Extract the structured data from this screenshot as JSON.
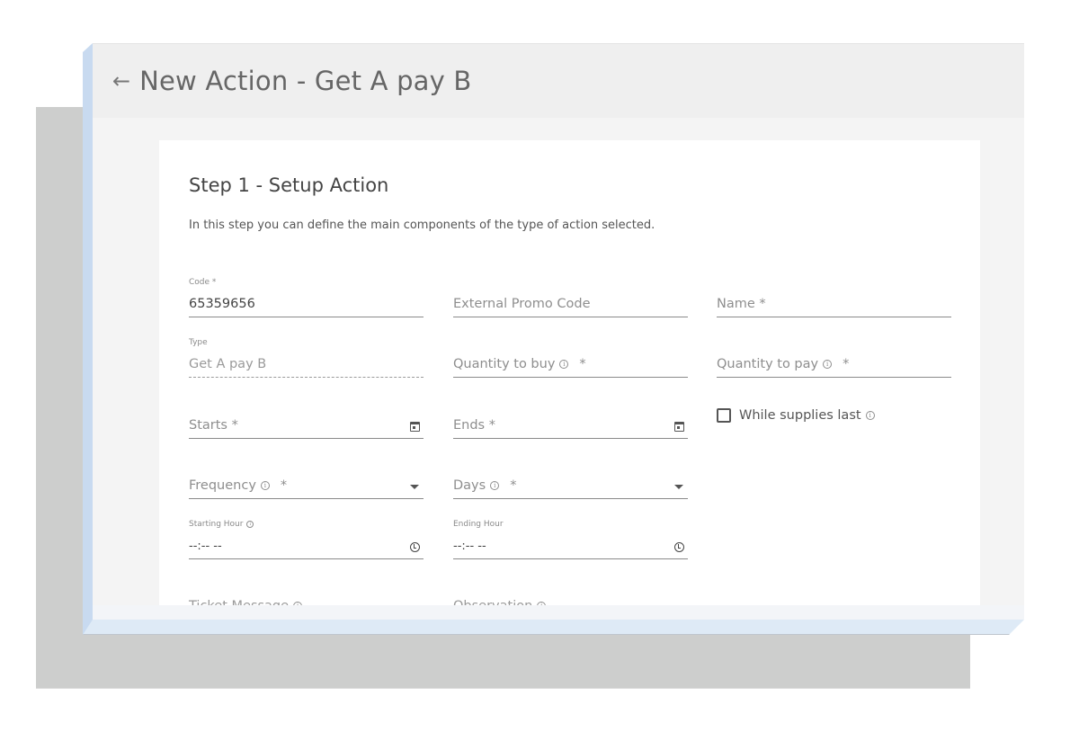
{
  "header": {
    "back_icon": "arrow-left-icon",
    "title": "New Action - Get A pay B"
  },
  "step": {
    "title": "Step 1 - Setup Action",
    "description": "In this step you can define the main components of the type of action selected."
  },
  "fields": {
    "code": {
      "label": "Code *",
      "value": "65359656"
    },
    "external_promo_code": {
      "placeholder": "External Promo Code"
    },
    "name": {
      "placeholder": "Name *"
    },
    "type": {
      "label": "Type",
      "value": "Get A pay B"
    },
    "quantity_to_buy": {
      "placeholder": "Quantity to buy",
      "required": "*"
    },
    "quantity_to_pay": {
      "placeholder": "Quantity to pay",
      "required": "*"
    },
    "starts": {
      "placeholder": "Starts *",
      "icon": "calendar-icon"
    },
    "ends": {
      "placeholder": "Ends *",
      "icon": "calendar-icon"
    },
    "while_supplies_last": {
      "label": "While supplies last",
      "checked": false
    },
    "frequency": {
      "placeholder": "Frequency",
      "required": "*",
      "icon": "dropdown-caret-icon"
    },
    "days": {
      "placeholder": "Days",
      "required": "*",
      "icon": "dropdown-caret-icon"
    },
    "starting_hour": {
      "label": "Starting Hour",
      "value": "--:-- --",
      "icon": "clock-icon"
    },
    "ending_hour": {
      "label": "Ending Hour",
      "value": "--:-- --",
      "icon": "clock-icon"
    },
    "ticket_message": {
      "label": "Ticket Message"
    },
    "observation": {
      "label": "Observation"
    }
  },
  "info_glyph": "i"
}
